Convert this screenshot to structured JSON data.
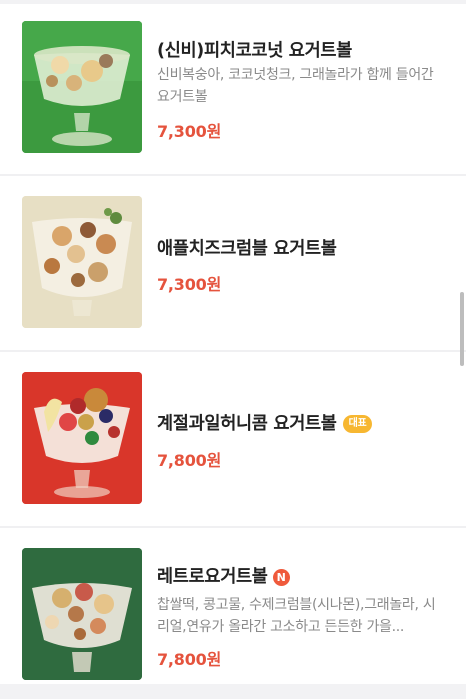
{
  "menu_items": [
    {
      "name": "(신비)피치코코넛 요거트볼",
      "description": "신비복숭아, 코코넛청크, 그래놀라가 함께 들어간 요거트볼",
      "price": "7,300원",
      "image_bg": "#3c9a3f"
    },
    {
      "name": "애플치즈크럼블 요거트볼",
      "price": "7,300원",
      "image_bg": "#e7dfc4"
    },
    {
      "name": "계절과일허니콤 요거트볼",
      "badge": "대표",
      "price": "7,800원",
      "image_bg": "#d9362a"
    },
    {
      "name": "레트로요거트볼",
      "badge": "N",
      "description": "찹쌀떡, 콩고물, 수제크럼블(시나몬),그래놀라, 시리얼,연유가 올라간 고소하고 든든한 가을...",
      "price": "7,800원",
      "image_bg": "#2f6b3f"
    }
  ],
  "colors": {
    "price": "#e5533d",
    "badge_representative": "#f7b731",
    "badge_new": "#ef5a3c",
    "divider": "#f0f0f2"
  }
}
